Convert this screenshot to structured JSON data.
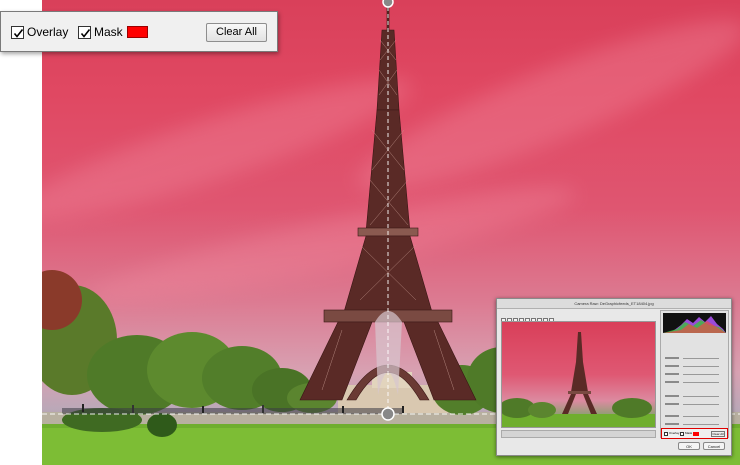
{
  "toolbar": {
    "overlay": {
      "label": "Overlay",
      "checked": true
    },
    "mask": {
      "label": "Mask",
      "checked": true,
      "color": "#ff0000"
    },
    "clear_all_label": "Clear All"
  },
  "photo": {
    "subject": "eiffel-tower",
    "overlay_color": "#ff0000"
  },
  "inset_dialog": {
    "title": "Camera Raw: DeGraphicfeeds_ET18404.jpg",
    "overlay_label": "Overlay",
    "mask_label": "Mask",
    "clear_all_label": "Clear All",
    "ok_label": "OK",
    "cancel_label": "Cancel"
  },
  "colors": {
    "accent_red": "#ff0000",
    "toolbar_bg": "#f0f0f0"
  }
}
